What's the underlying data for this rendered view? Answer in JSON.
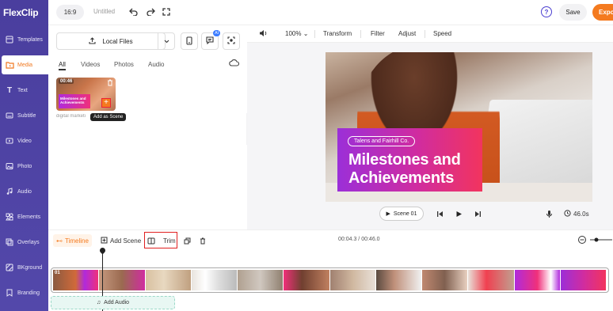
{
  "app": {
    "logo": "FlexClip"
  },
  "sidebar": {
    "items": [
      {
        "label": "Templates",
        "icon": "templates-icon"
      },
      {
        "label": "Media",
        "icon": "media-icon",
        "active": true
      },
      {
        "label": "Text",
        "icon": "text-icon"
      },
      {
        "label": "Subtitle",
        "icon": "subtitle-icon"
      },
      {
        "label": "Video",
        "icon": "video-icon"
      },
      {
        "label": "Photo",
        "icon": "photo-icon"
      },
      {
        "label": "Audio",
        "icon": "audio-icon"
      },
      {
        "label": "Elements",
        "icon": "elements-icon"
      },
      {
        "label": "Overlays",
        "icon": "overlays-icon"
      },
      {
        "label": "BKground",
        "icon": "background-icon"
      },
      {
        "label": "Branding",
        "icon": "branding-icon"
      }
    ]
  },
  "topbar": {
    "ratio": "16:9",
    "title": "Untitled",
    "help": "?",
    "save": "Save",
    "export": "Expo"
  },
  "media": {
    "local_files": "Local Files",
    "ai_badge": "AI",
    "tabs": [
      "All",
      "Videos",
      "Photos",
      "Audio"
    ],
    "asset": {
      "duration": "00:46",
      "overlay_text_1": "Milestones and",
      "overlay_text_2": "Achievements",
      "name": "digital marketi",
      "add_icon": "+"
    },
    "tooltip": "Add as Scene"
  },
  "preview_toolbar": {
    "zoom": "100%",
    "transform": "Transform",
    "filter": "Filter",
    "adjust": "Adjust",
    "speed": "Speed"
  },
  "canvas": {
    "company": "Talens and Fairhill Co.",
    "headline_1": "Milestones and",
    "headline_2": "Achievements"
  },
  "player": {
    "scene": "Scene 01",
    "duration": "46.0s"
  },
  "timeline": {
    "timeline_label": "Timeline",
    "add_scene": "Add Scene",
    "trim": "Trim",
    "timecode": "00:04.3 / 00:46.0",
    "scene_number": "01",
    "add_audio": "Add Audio"
  },
  "colors": {
    "sidebar": "#4b3fa0",
    "accent": "#f47a1f",
    "trim_highlight": "#e02020"
  }
}
